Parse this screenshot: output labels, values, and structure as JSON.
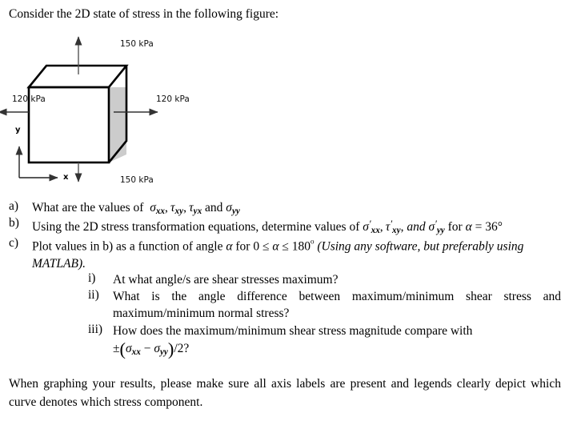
{
  "document": {
    "intro": "Consider the 2D state of stress in the following figure:"
  },
  "figure": {
    "name": "2d-stress-state-cube-diagram",
    "top_label": "150 kPa",
    "bottom_label": "150 kPa",
    "left_label": "120 kPa",
    "right_label": "120 kPa",
    "axis_y_label": "y",
    "axis_x_label": "x",
    "cube_front_face_color": "#ffffff",
    "cube_right_face_color": "#cccccc",
    "cube_top_face_color": "#ffffff",
    "outline_color": "#000000",
    "arrow_color": "#333333"
  },
  "questions": [
    {
      "marker": "a)",
      "text_before": "What are the values of",
      "math": "σxx, τxy, τyx and σyy"
    },
    {
      "marker": "b)",
      "text_before": "Using the 2D stress transformation equations, determine values of",
      "math": "σ'xx, τ'xy, and σ'yy for α = 36°"
    },
    {
      "marker": "c)",
      "text": "Plot values in b) as a function of angle α for 0 ≤ α ≤ 180⁰",
      "italic_note": "(Using any software, but preferably using MATLAB)."
    }
  ],
  "sub_questions": [
    {
      "marker": "i)",
      "text": "At what angle/s are shear stresses maximum?"
    },
    {
      "marker": "ii)",
      "text": "What is the angle difference between maximum/minimum shear stress and maximum/minimum normal stress?"
    },
    {
      "marker": "iii)",
      "text": "How does the maximum/minimum shear stress magnitude compare with",
      "formula": "±(σxx − σyy)/2?"
    }
  ],
  "closing": {
    "text": "When graphing your results, please make sure all axis labels are present and legends clearly depict which curve denotes which stress component."
  },
  "math_tokens": {
    "sigma": "σ",
    "tau": "τ",
    "alpha": "α",
    "prime": "′",
    "leq": "≤",
    "plusminus": "±",
    "minus": "−",
    "degree": "°",
    "sup_zero": "⁰",
    "sub_xx": "xx",
    "sub_xy": "xy",
    "sub_yx": "yx",
    "sub_yy": "yy",
    "angle_value": "36",
    "range_max": "180",
    "divisor": "2"
  }
}
